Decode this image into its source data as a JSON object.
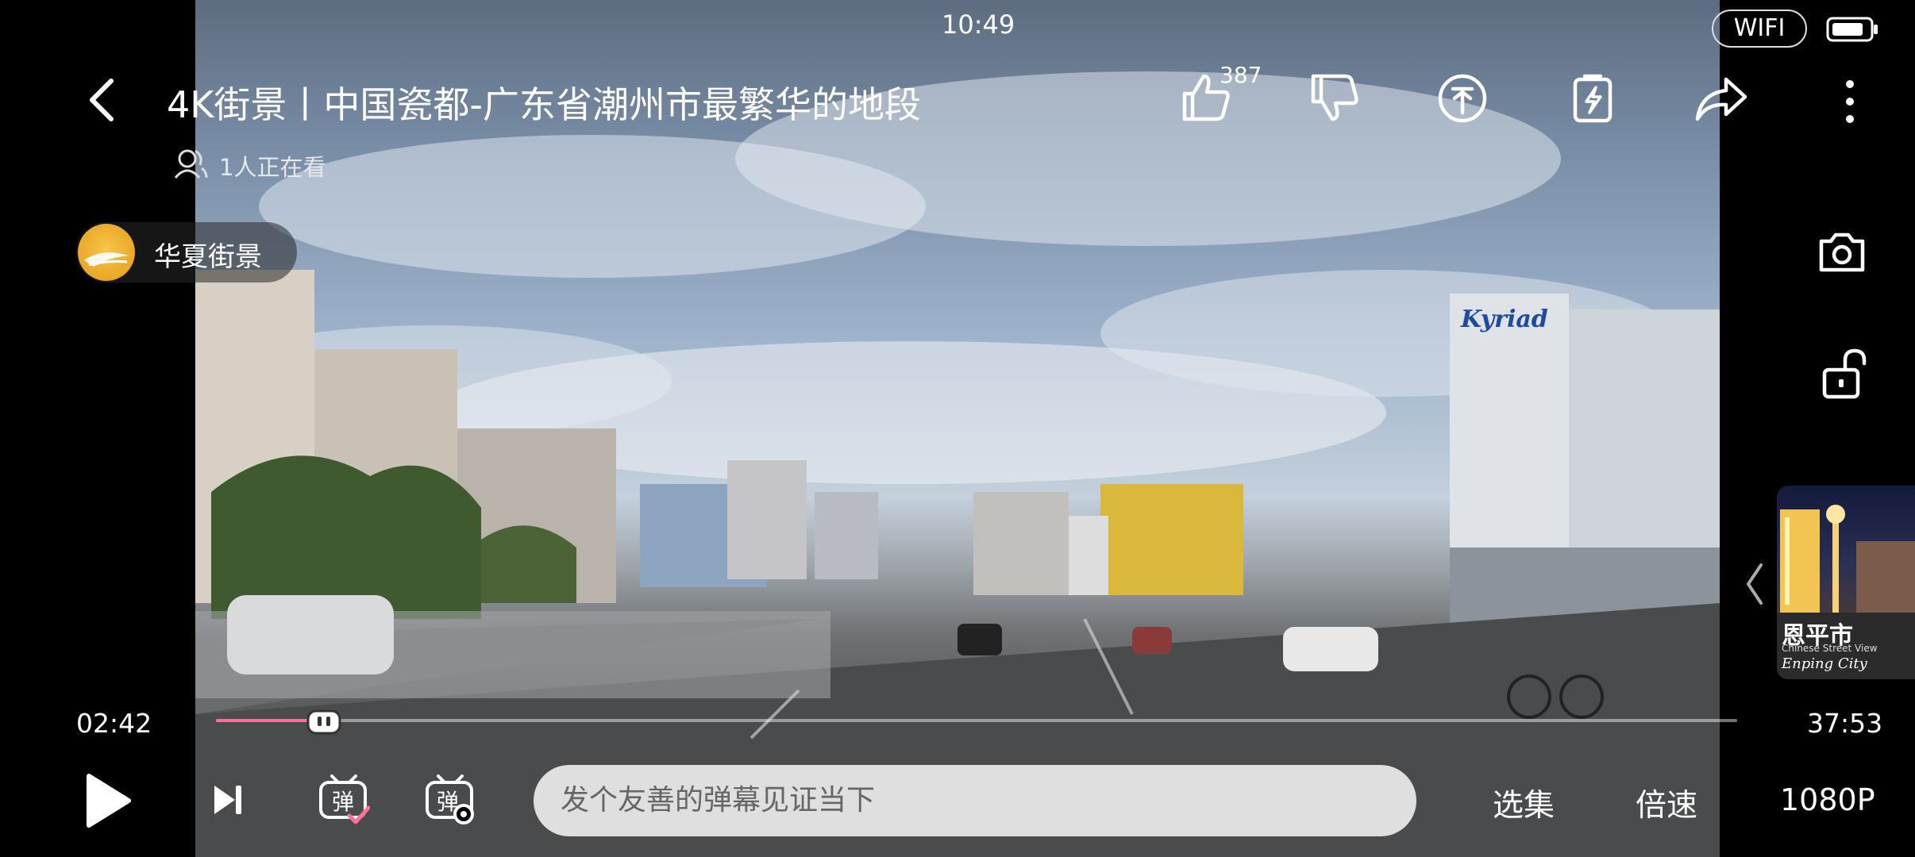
{
  "status_bar": {
    "time": "10:49",
    "network": "WIFI"
  },
  "header": {
    "title": "4K街景丨中国瓷都-广东省潮州市最繁华的地段",
    "viewers": "1人正在看",
    "like_count": "387"
  },
  "channel": {
    "name": "华夏街景"
  },
  "recommendation": {
    "title": "恩平市",
    "subtitle": "Chinese Street View",
    "subtitle_en": "Enping City"
  },
  "player": {
    "current_time": "02:42",
    "total_time": "37:53",
    "progress_fraction": 0.0712,
    "danmaku_placeholder": "发个友善的弹幕见证当下",
    "episodes_label": "选集",
    "speed_label": "倍速",
    "quality_label": "1080P"
  },
  "colors": {
    "accent": "#fb7299",
    "icon": "#ffffff",
    "input_bg": "#ebebeb"
  },
  "icons": [
    "back-arrow-icon",
    "viewers-icon",
    "like-icon",
    "dislike-icon",
    "coin-icon",
    "charge-icon",
    "share-icon",
    "more-vertical-icon",
    "camera-icon",
    "unlock-icon",
    "chevron-left-icon",
    "play-icon",
    "next-icon",
    "danmaku-toggle-icon",
    "danmaku-settings-icon",
    "battery-icon"
  ]
}
